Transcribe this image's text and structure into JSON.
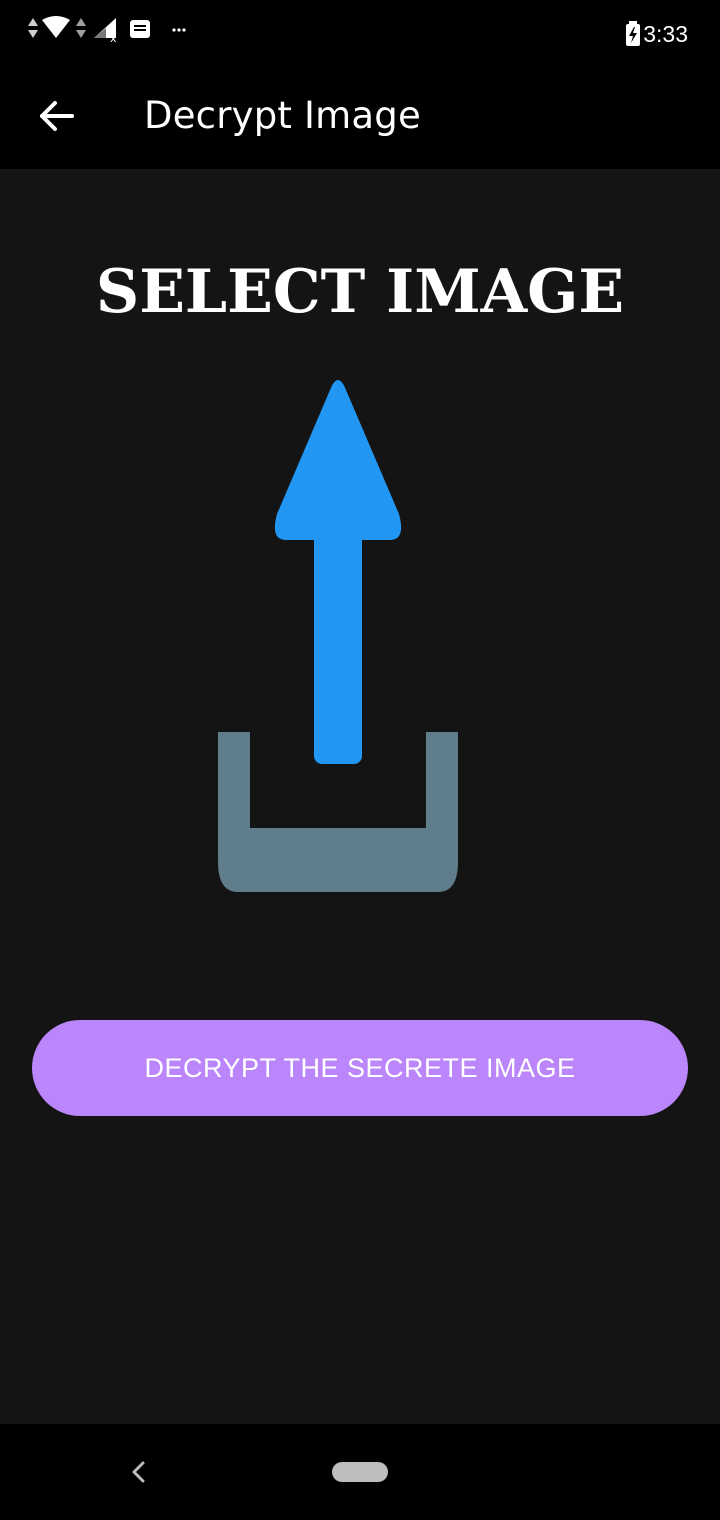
{
  "status_bar": {
    "time": "3:33",
    "icons": [
      "data-arrows-icon",
      "wifi-icon",
      "data-arrows-icon",
      "signal-no-service-icon",
      "notification-message-icon",
      "more-notifications-icon",
      "battery-charging-icon"
    ]
  },
  "app_bar": {
    "title": "Decrypt Image",
    "back_icon": "arrow-back-icon"
  },
  "main": {
    "heading": "SELECT IMAGE",
    "upload_icon": "upload-icon",
    "decrypt_button_label": "DECRYPT THE SECRETE IMAGE"
  },
  "nav_bar": {
    "back_icon": "chevron-left-icon",
    "home_icon": "home-pill-icon"
  },
  "colors": {
    "background": "#141414",
    "bar": "#000000",
    "accent": "#bb86fc",
    "arrow_blue": "#2196f3",
    "tray_gray": "#607d8b"
  }
}
